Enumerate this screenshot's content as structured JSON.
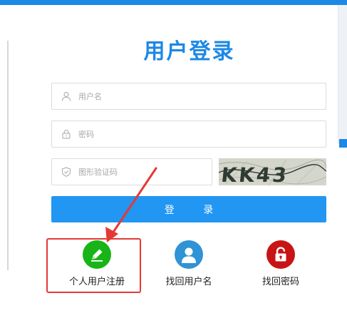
{
  "title": "用户登录",
  "form": {
    "username_placeholder": "用户名",
    "username_value": "",
    "password_placeholder": "密码",
    "password_value": "",
    "captcha_placeholder": "图形验证码",
    "captcha_value": "",
    "captcha_text": "KK43"
  },
  "login_button": "登 录",
  "options": [
    {
      "label": "个人用户注册",
      "icon": "pencil-icon",
      "color": "#18b418"
    },
    {
      "label": "找回用户名",
      "icon": "person-icon",
      "color": "#2f93d5"
    },
    {
      "label": "找回密码",
      "icon": "lock-icon",
      "color": "#c81414"
    }
  ],
  "colors": {
    "accent": "#1e88e5",
    "button": "#2196f3",
    "highlight": "#e53935"
  }
}
